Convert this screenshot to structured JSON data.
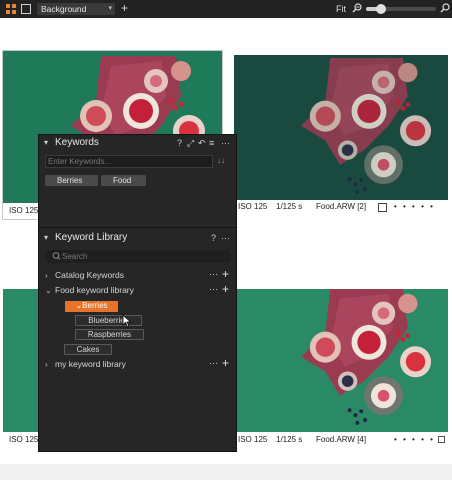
{
  "toolbar": {
    "collection_select": "Background",
    "fit_label": "Fit",
    "zoom_level": 0.22,
    "icons": [
      "grid-view-icon",
      "single-view-icon",
      "chevron-down-icon",
      "add-icon",
      "zoom-out-icon",
      "zoom-in-icon"
    ]
  },
  "browser": {
    "thumbnails": [
      {
        "iso": "ISO 125",
        "shutter": "",
        "filename": "",
        "dots": "",
        "selected": true
      },
      {
        "iso": "ISO 125",
        "shutter": "1/125 s",
        "filename": "Food.ARW [2]",
        "dots": "• • • • •",
        "selected": false
      },
      {
        "iso": "ISO 125",
        "shutter": "",
        "filename": "",
        "dots": "",
        "selected": false
      },
      {
        "iso": "ISO 125",
        "shutter": "1/125 s",
        "filename": "Food.ARW [4]",
        "dots": "• • • • •",
        "selected": false
      }
    ]
  },
  "keywords_panel": {
    "title": "Keywords",
    "help": "?",
    "input_placeholder": "Enter Keywords...",
    "sort_icon": "↓↓",
    "applied": [
      "Berries",
      "Food"
    ],
    "more": "···"
  },
  "library_panel": {
    "title": "Keyword Library",
    "help": "?",
    "more": "···",
    "search_placeholder": "Search",
    "rows": [
      {
        "label": "Catalog Keywords",
        "expanded": false,
        "more": "···",
        "add": "+"
      },
      {
        "label": "Food keyword library",
        "expanded": true,
        "more": "···",
        "add": "+"
      },
      {
        "label": "my keyword library",
        "expanded": false,
        "more": "···",
        "add": "+"
      }
    ],
    "tree": {
      "selected": "Berries",
      "children": [
        "Blueberries",
        "Raspberries"
      ],
      "sibling": "Cakes"
    }
  },
  "colors": {
    "accent": "#e8742c",
    "panel_bg": "#262626",
    "toolbar_bg": "#232323",
    "photo_green": "#1f7a5a",
    "photo_green_dark": "#1a4a3f"
  }
}
